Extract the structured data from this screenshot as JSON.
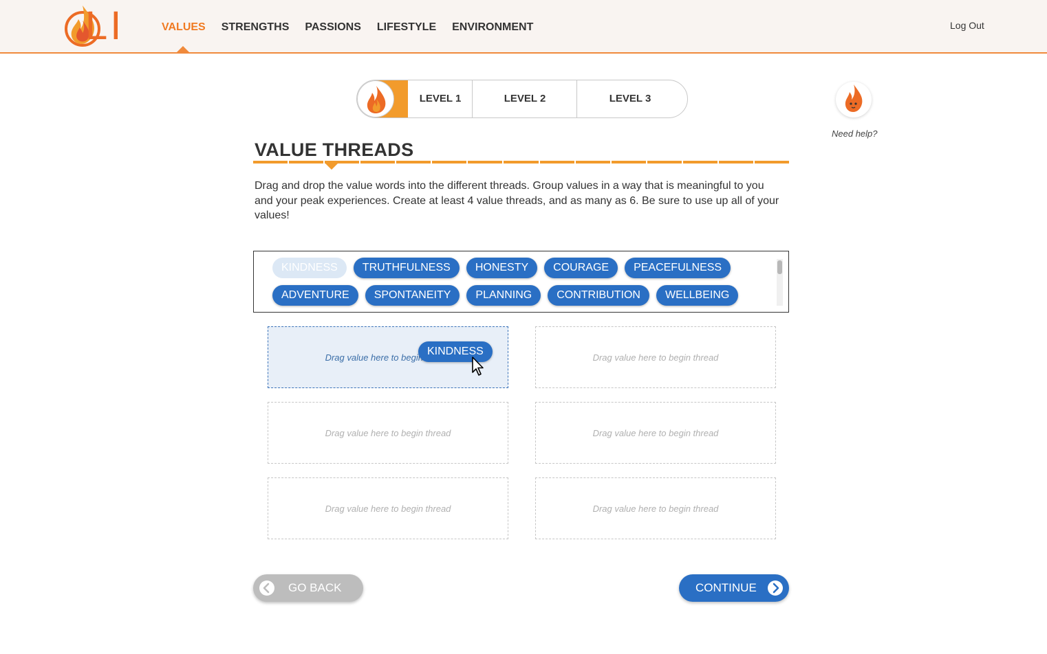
{
  "header": {
    "logo_text": "LI",
    "nav": [
      {
        "label": "VALUES",
        "active": true
      },
      {
        "label": "STRENGTHS",
        "active": false
      },
      {
        "label": "PASSIONS",
        "active": false
      },
      {
        "label": "LIFESTYLE",
        "active": false
      },
      {
        "label": "ENVIRONMENT",
        "active": false
      }
    ],
    "logout_label": "Log Out"
  },
  "levels": {
    "tabs": [
      "LEVEL 1",
      "LEVEL 2",
      "LEVEL 3"
    ],
    "active_index": 0
  },
  "help": {
    "label": "Need help?"
  },
  "main": {
    "title": "VALUE THREADS",
    "progress_steps": 15,
    "progress_current": 3,
    "instructions": "Drag and drop the value words into the different threads. Group values in a way that is meaningful to you and your peak experiences. Create at least 4 value threads, and as many as 6. Be sure to use up all of your values!"
  },
  "word_bank": {
    "row1": [
      "KINDNESS",
      "TRUTHFULNESS",
      "HONESTY",
      "COURAGE",
      "PEACEFULNESS"
    ],
    "row2": [
      "ADVENTURE",
      "SPONTANEITY",
      "PLANNING",
      "CONTRIBUTION",
      "WELLBEING"
    ],
    "dragging_value": "KINDNESS"
  },
  "threads": {
    "placeholder": "Drag value here to begin thread",
    "count": 6,
    "hovered_index": 0
  },
  "buttons": {
    "back_label": "GO BACK",
    "continue_label": "CONTINUE"
  },
  "colors": {
    "accent_orange": "#f08a3c",
    "pill_blue": "#2a6fc4",
    "back_gray": "#bdbdbd"
  }
}
